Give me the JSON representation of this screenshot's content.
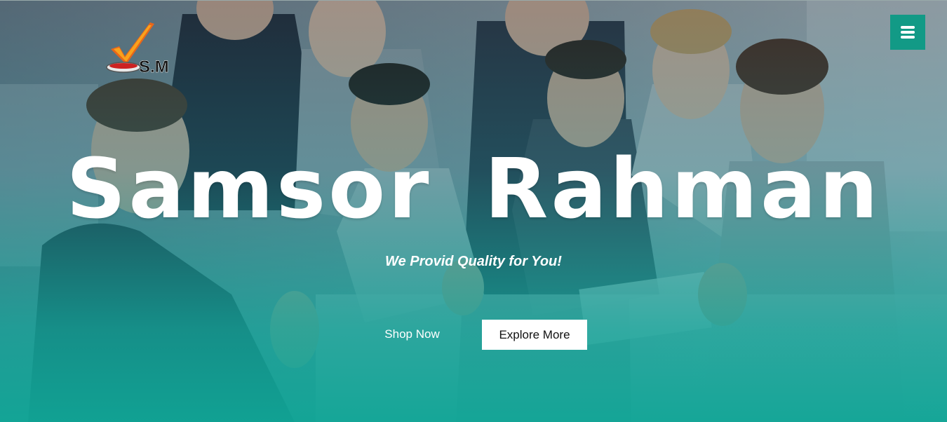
{
  "brand": {
    "logo_text": "S.M",
    "logo_icon": "checkmark-icon"
  },
  "nav": {
    "menu_icon": "hamburger-menu-icon"
  },
  "hero": {
    "title": "Samsor Rahman",
    "tagline": "We Provid Quality for You!",
    "primary_button": "Shop Now",
    "secondary_button": "Explore More"
  },
  "colors": {
    "accent": "#129a86",
    "overlay_bottom": "#10a596",
    "text": "#ffffff"
  }
}
